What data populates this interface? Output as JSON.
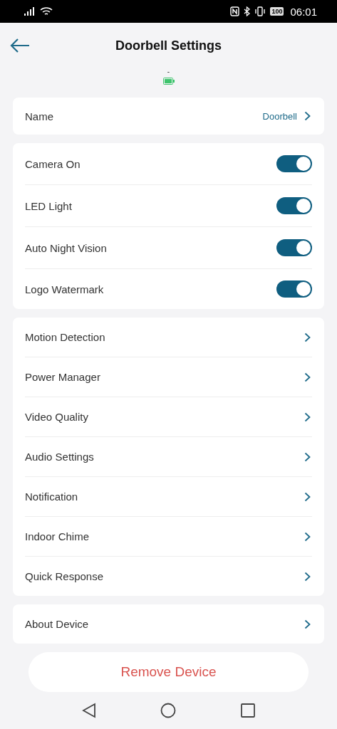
{
  "status_bar": {
    "battery": "100",
    "time": "06:01"
  },
  "header": {
    "title": "Doorbell Settings",
    "subtitle": "-"
  },
  "name_row": {
    "label": "Name",
    "value": "Doorbell"
  },
  "toggles": [
    {
      "label": "Camera On",
      "on": true
    },
    {
      "label": "LED Light",
      "on": true
    },
    {
      "label": "Auto Night Vision",
      "on": true
    },
    {
      "label": "Logo Watermark",
      "on": true
    }
  ],
  "menu": [
    "Motion Detection",
    "Power Manager",
    "Video Quality",
    "Audio Settings",
    "Notification",
    "Indoor Chime",
    "Quick Response"
  ],
  "about": "About Device",
  "remove_button": "Remove Device"
}
